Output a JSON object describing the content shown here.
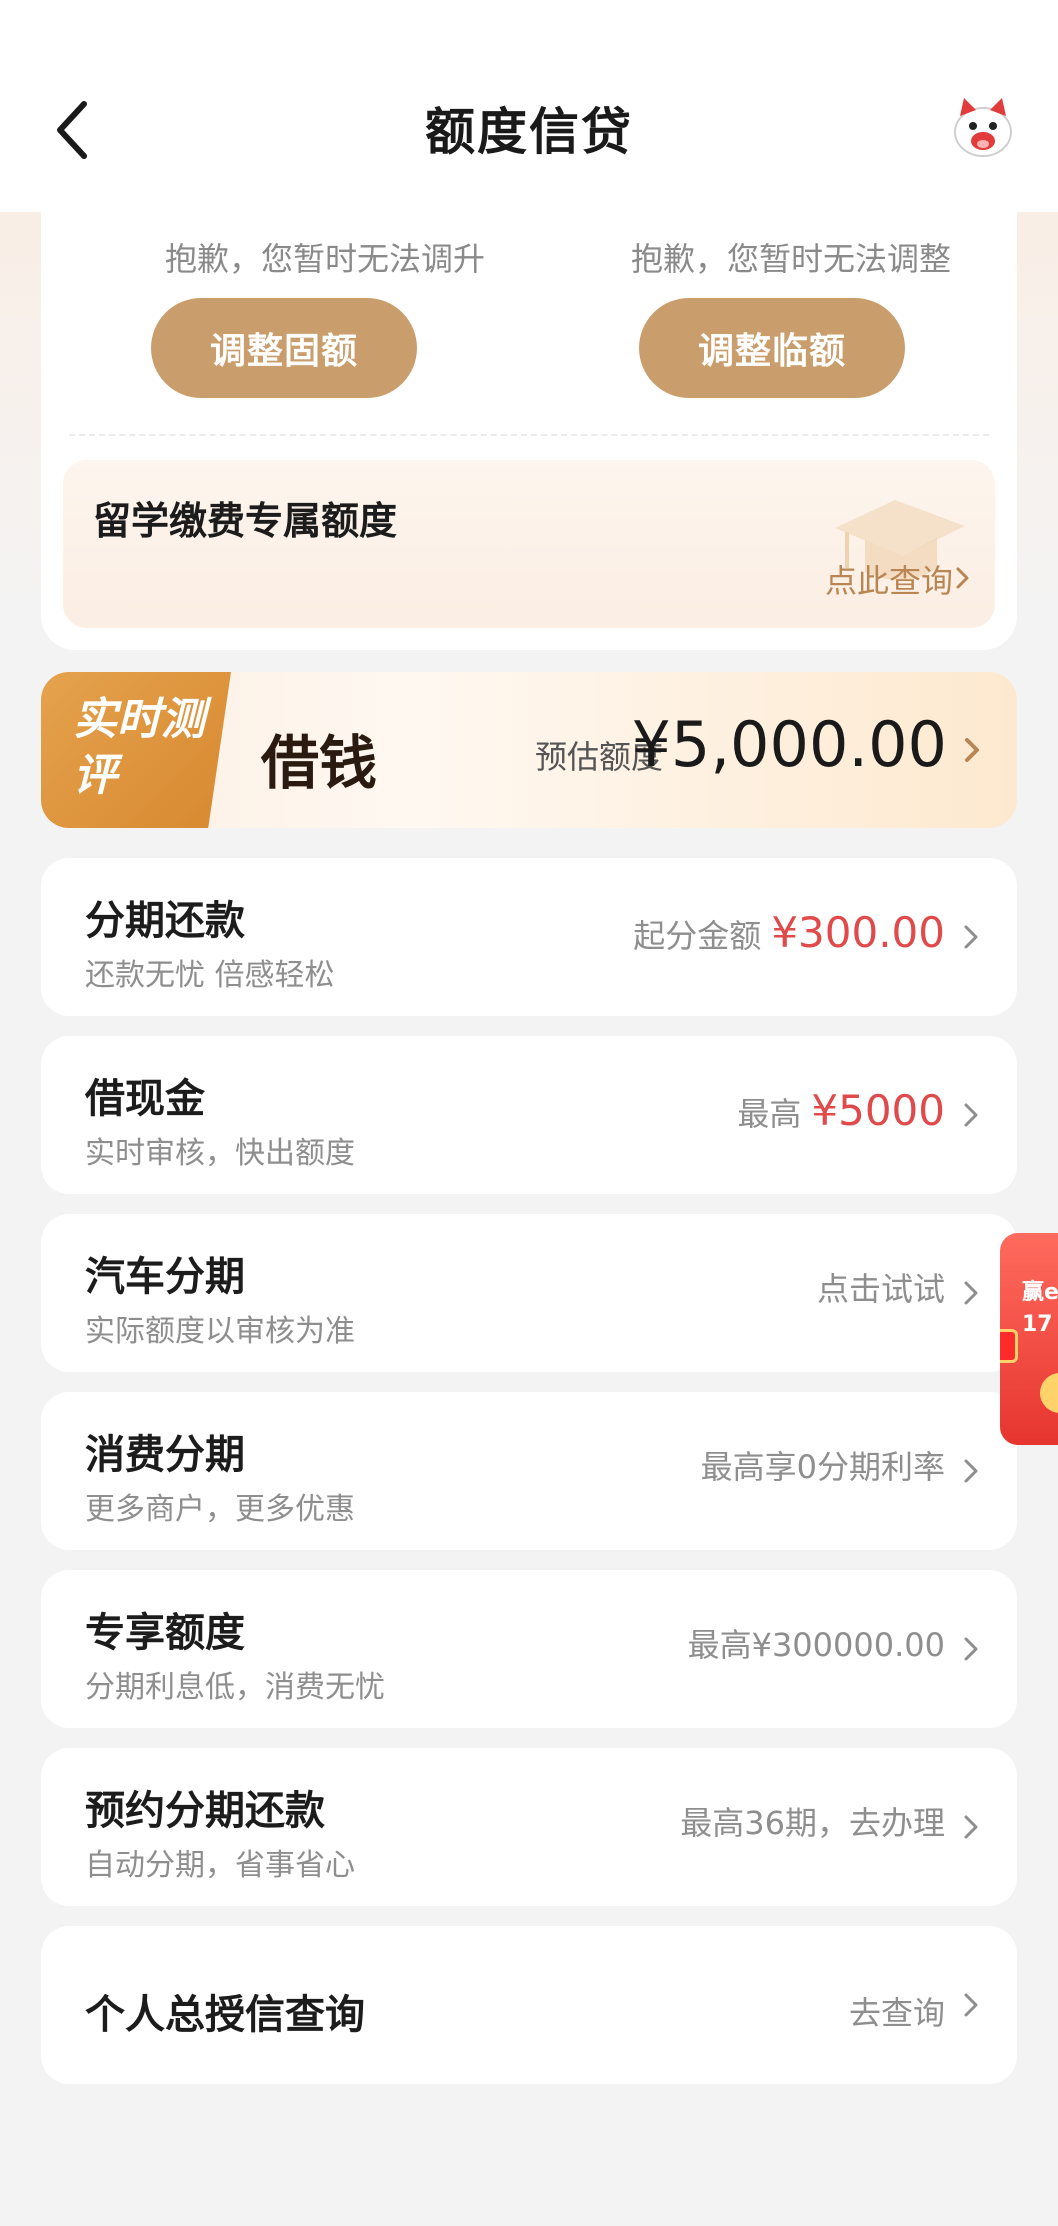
{
  "header": {
    "title": "额度信贷"
  },
  "adjust": {
    "left_hint": "抱歉，您暂时无法调升",
    "right_hint": "抱歉，您暂时无法调整",
    "fixed_button": "调整固额",
    "temp_button": "调整临额"
  },
  "study": {
    "title": "留学缴费专属额度",
    "link": "点此查询"
  },
  "borrow": {
    "tag": "实时测评",
    "title": "借钱",
    "estimate_label": "预估额度",
    "estimate_amount": "¥5,000.00"
  },
  "rows": [
    {
      "title": "分期还款",
      "subtitle": "还款无忧 倍感轻松",
      "label": "起分金额",
      "amount": "¥300.00"
    },
    {
      "title": "借现金",
      "subtitle": "实时审核，快出额度",
      "label": "最高",
      "amount": "¥5000"
    },
    {
      "title": "汽车分期",
      "subtitle": "实际额度以审核为准",
      "label": "点击试试",
      "amount": ""
    },
    {
      "title": "消费分期",
      "subtitle": "更多商户，更多优惠",
      "label": "最高享0分期利率",
      "amount": ""
    },
    {
      "title": "专享额度",
      "subtitle": "分期利息低，消费无忧",
      "label": "最高¥300000.00",
      "amount": ""
    },
    {
      "title": "预约分期还款",
      "subtitle": "自动分期，省事省心",
      "label": "最高36期，去办理",
      "amount": ""
    },
    {
      "title": "个人总授信查询",
      "subtitle": "",
      "label": "去查询",
      "amount": ""
    }
  ],
  "promo": {
    "line1": "赢e",
    "line2": "17"
  },
  "colors": {
    "accent_gold": "#c99e6c",
    "amount_red": "#e04a4a",
    "tag_orange": "#d78930"
  },
  "icons": {
    "back": "chevron-left-icon",
    "mascot": "cat-mascot-icon",
    "chevron": "chevron-right-icon",
    "graduation": "graduation-cap-icon"
  }
}
